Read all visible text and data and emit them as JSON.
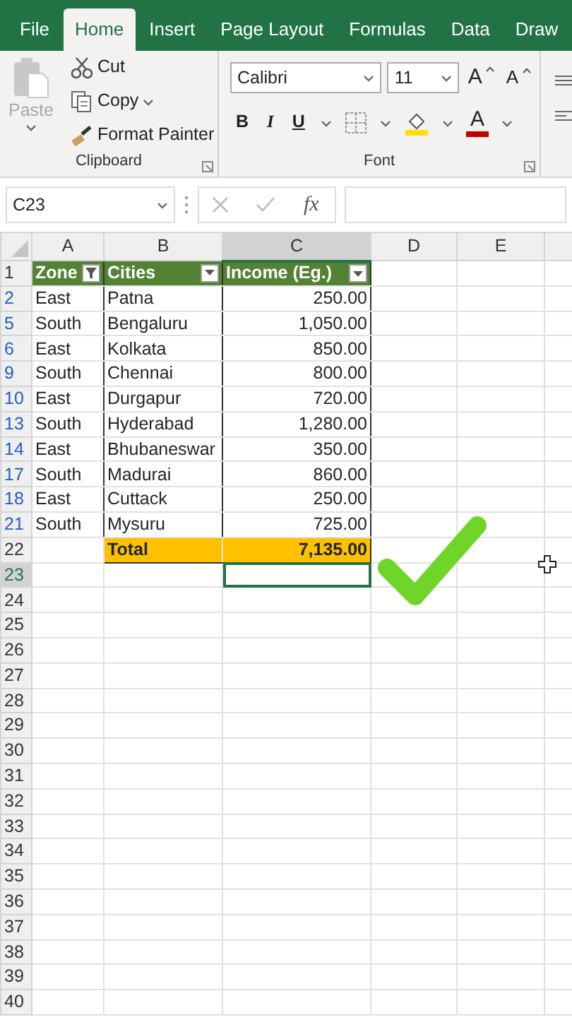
{
  "tabs": [
    {
      "label": "File",
      "selected": false
    },
    {
      "label": "Home",
      "selected": true
    },
    {
      "label": "Insert",
      "selected": false
    },
    {
      "label": "Page Layout",
      "selected": false
    },
    {
      "label": "Formulas",
      "selected": false
    },
    {
      "label": "Data",
      "selected": false
    },
    {
      "label": "Draw",
      "selected": false
    }
  ],
  "clipboard": {
    "paste": {
      "label": "Paste",
      "disabled": true
    },
    "items": [
      {
        "kind": "cut",
        "label": "Cut"
      },
      {
        "kind": "copy",
        "label": "Copy"
      },
      {
        "kind": "painter",
        "label": "Format Painter"
      }
    ],
    "group_label": "Clipboard"
  },
  "font": {
    "name": "Calibri",
    "size": "11",
    "grow": "A",
    "shrink": "A",
    "bold": "B",
    "italic": "I",
    "underline": "U",
    "font_color": "A",
    "group_label": "Font"
  },
  "formula_bar": {
    "name_box": "C23",
    "fx": "fx"
  },
  "columns": [
    {
      "label": "A",
      "selected": false
    },
    {
      "label": "B",
      "selected": false
    },
    {
      "label": "C",
      "selected": true
    },
    {
      "label": "D",
      "selected": false
    },
    {
      "label": "E",
      "selected": false
    }
  ],
  "table_header": {
    "number": "1",
    "cells": [
      {
        "label": "Zone",
        "filter_active": true
      },
      {
        "label": "Cities",
        "filter_active": false
      },
      {
        "label": "Income (Eg.)",
        "filter_active": false
      }
    ]
  },
  "rows": [
    {
      "number": "2",
      "kind": "data",
      "filtered": true,
      "selected": false,
      "cells": [
        "East",
        "Patna",
        "250.00"
      ]
    },
    {
      "number": "5",
      "kind": "data",
      "filtered": true,
      "selected": false,
      "cells": [
        "South",
        "Bengaluru",
        "1,050.00"
      ]
    },
    {
      "number": "6",
      "kind": "data",
      "filtered": true,
      "selected": false,
      "cells": [
        "East",
        "Kolkata",
        "850.00"
      ]
    },
    {
      "number": "9",
      "kind": "data",
      "filtered": true,
      "selected": false,
      "cells": [
        "South",
        "Chennai",
        "800.00"
      ]
    },
    {
      "number": "10",
      "kind": "data",
      "filtered": true,
      "selected": false,
      "cells": [
        "East",
        "Durgapur",
        "720.00"
      ]
    },
    {
      "number": "13",
      "kind": "data",
      "filtered": true,
      "selected": false,
      "cells": [
        "South",
        "Hyderabad",
        "1,280.00"
      ]
    },
    {
      "number": "14",
      "kind": "data",
      "filtered": true,
      "selected": false,
      "cells": [
        "East",
        "Bhubaneswar",
        "350.00"
      ]
    },
    {
      "number": "17",
      "kind": "data",
      "filtered": true,
      "selected": false,
      "cells": [
        "South",
        "Madurai",
        "860.00"
      ]
    },
    {
      "number": "18",
      "kind": "data",
      "filtered": true,
      "selected": false,
      "cells": [
        "East",
        "Cuttack",
        "250.00"
      ]
    },
    {
      "number": "21",
      "kind": "data",
      "filtered": true,
      "selected": false,
      "cells": [
        "South",
        "Mysuru",
        "725.00"
      ]
    },
    {
      "number": "22",
      "kind": "total",
      "filtered": false,
      "selected": false,
      "cells": [
        "",
        "Total",
        "7,135.00"
      ]
    },
    {
      "number": "23",
      "kind": "empty",
      "filtered": false,
      "selected": true
    },
    {
      "number": "24",
      "kind": "empty",
      "filtered": false,
      "selected": false
    },
    {
      "number": "25",
      "kind": "empty",
      "filtered": false,
      "selected": false
    },
    {
      "number": "26",
      "kind": "empty",
      "filtered": false,
      "selected": false
    },
    {
      "number": "27",
      "kind": "empty",
      "filtered": false,
      "selected": false
    },
    {
      "number": "28",
      "kind": "empty",
      "filtered": false,
      "selected": false
    },
    {
      "number": "29",
      "kind": "empty",
      "filtered": false,
      "selected": false
    },
    {
      "number": "30",
      "kind": "empty",
      "filtered": false,
      "selected": false
    },
    {
      "number": "31",
      "kind": "empty",
      "filtered": false,
      "selected": false
    },
    {
      "number": "32",
      "kind": "empty",
      "filtered": false,
      "selected": false
    },
    {
      "number": "33",
      "kind": "empty",
      "filtered": false,
      "selected": false
    },
    {
      "number": "34",
      "kind": "empty",
      "filtered": false,
      "selected": false
    },
    {
      "number": "35",
      "kind": "empty",
      "filtered": false,
      "selected": false
    },
    {
      "number": "36",
      "kind": "empty",
      "filtered": false,
      "selected": false
    },
    {
      "number": "37",
      "kind": "empty",
      "filtered": false,
      "selected": false
    },
    {
      "number": "38",
      "kind": "empty",
      "filtered": false,
      "selected": false
    },
    {
      "number": "39",
      "kind": "empty",
      "filtered": false,
      "selected": false
    },
    {
      "number": "40",
      "kind": "empty",
      "filtered": false,
      "selected": false
    }
  ]
}
